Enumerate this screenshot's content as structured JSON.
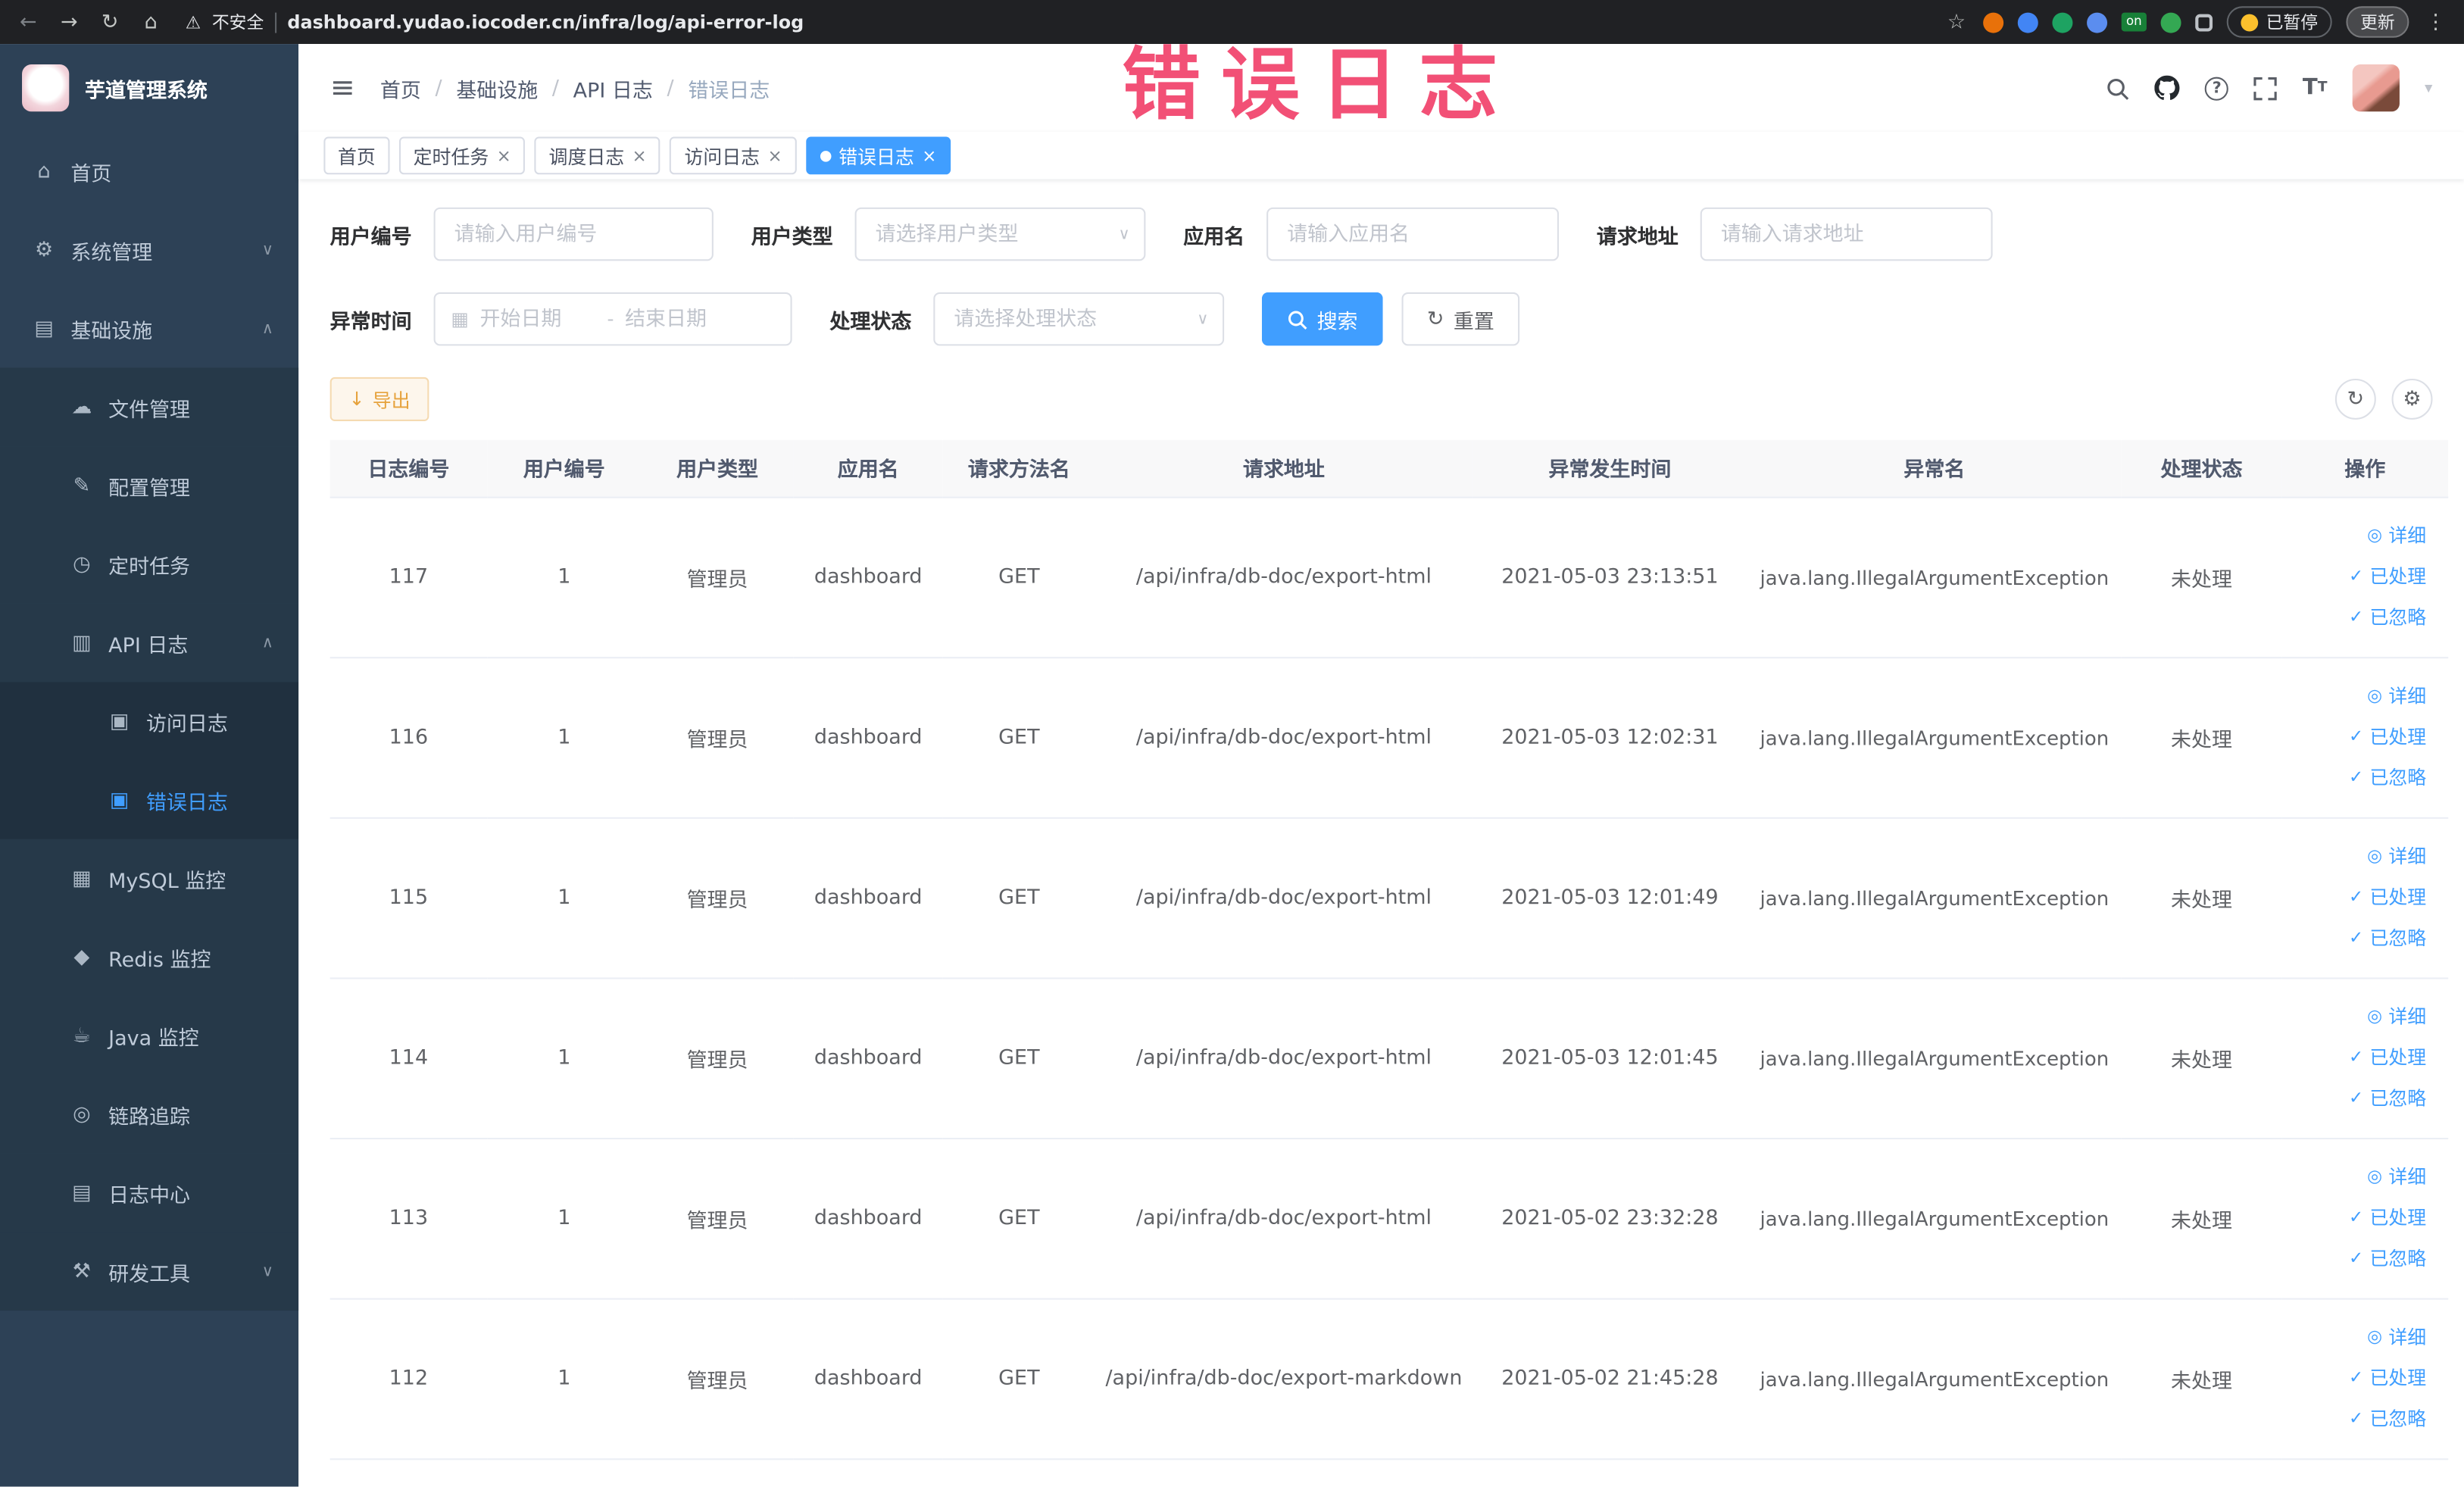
{
  "colors": {
    "accent": "#409eff",
    "sidebar_bg": "#2d4156",
    "submenu_bg": "#263949",
    "link": "#409eff",
    "warning_text": "#e6a23c",
    "warning_bg": "#fdf6ec",
    "annotation": "#f1426b",
    "tag_active": "#409eff"
  },
  "icons": {
    "back": "←",
    "forward": "→",
    "reload": "↻",
    "home": "⌂",
    "warning": "⚠",
    "star": "☆",
    "kebab": "⋮",
    "hamburger": "≡",
    "chevron_down": "∨",
    "chevron_up": "∧",
    "close": "×",
    "dot": "●",
    "eye": "◎",
    "check": "✓",
    "refresh": "↻",
    "settings": "⚙",
    "download": "↓",
    "calendar": "▦",
    "caret_down": "▾",
    "question": "?",
    "font_size": "T"
  },
  "browser": {
    "security_label": "不安全",
    "url": "dashboard.yudao.iocoder.cn/infra/log/api-error-log",
    "paused_badge": "已暂停",
    "update_label": "更新",
    "on_badge": "on"
  },
  "annotation": {
    "text": "错误日志"
  },
  "sidebar": {
    "logo_title": "芋道管理系统",
    "items": [
      {
        "label": "首页",
        "icon": "⌂"
      },
      {
        "label": "系统管理",
        "icon": "⚙"
      },
      {
        "label": "基础设施",
        "icon": "▤"
      },
      {
        "label": "文件管理",
        "icon": "☁"
      },
      {
        "label": "配置管理",
        "icon": "✎"
      },
      {
        "label": "定时任务",
        "icon": "◷"
      },
      {
        "label": "API 日志",
        "icon": "▥"
      },
      {
        "label": "访问日志",
        "icon": "▣"
      },
      {
        "label": "错误日志",
        "icon": "▣"
      },
      {
        "label": "MySQL 监控",
        "icon": "▦"
      },
      {
        "label": "Redis 监控",
        "icon": "◆"
      },
      {
        "label": "Java 监控",
        "icon": "☕"
      },
      {
        "label": "链路追踪",
        "icon": "◎"
      },
      {
        "label": "日志中心",
        "icon": "▤"
      },
      {
        "label": "研发工具",
        "icon": "⚒"
      }
    ]
  },
  "breadcrumb": {
    "separator": "/",
    "items": [
      "首页",
      "基础设施",
      "API 日志",
      "错误日志"
    ]
  },
  "tabs": [
    {
      "label": "首页"
    },
    {
      "label": "定时任务"
    },
    {
      "label": "调度日志"
    },
    {
      "label": "访问日志"
    },
    {
      "label": "错误日志"
    }
  ],
  "filters": {
    "user_id": {
      "label": "用户编号",
      "placeholder": "请输入用户编号"
    },
    "user_type": {
      "label": "用户类型",
      "placeholder": "请选择用户类型"
    },
    "app_name": {
      "label": "应用名",
      "placeholder": "请输入应用名"
    },
    "request_url": {
      "label": "请求地址",
      "placeholder": "请输入请求地址"
    },
    "exception_time": {
      "label": "异常时间",
      "start_placeholder": "开始日期",
      "separator": "-",
      "end_placeholder": "结束日期"
    },
    "process_status": {
      "label": "处理状态",
      "placeholder": "请选择处理状态"
    },
    "search_label": "搜索",
    "reset_label": "重置"
  },
  "toolbar": {
    "export_label": "导出"
  },
  "table": {
    "columns": [
      "日志编号",
      "用户编号",
      "用户类型",
      "应用名",
      "请求方法名",
      "请求地址",
      "异常发生时间",
      "异常名",
      "处理状态",
      "操作"
    ],
    "actions": {
      "detail": "详细",
      "processed": "已处理",
      "ignored": "已忽略"
    },
    "rows": [
      {
        "id": "117",
        "user_id": "1",
        "user_type": "管理员",
        "app_name": "dashboard",
        "method": "GET",
        "url": "/api/infra/db-doc/export-html",
        "time": "2021-05-03 23:13:51",
        "exception": "java.lang.IllegalArgumentException",
        "status": "未处理"
      },
      {
        "id": "116",
        "user_id": "1",
        "user_type": "管理员",
        "app_name": "dashboard",
        "method": "GET",
        "url": "/api/infra/db-doc/export-html",
        "time": "2021-05-03 12:02:31",
        "exception": "java.lang.IllegalArgumentException",
        "status": "未处理"
      },
      {
        "id": "115",
        "user_id": "1",
        "user_type": "管理员",
        "app_name": "dashboard",
        "method": "GET",
        "url": "/api/infra/db-doc/export-html",
        "time": "2021-05-03 12:01:49",
        "exception": "java.lang.IllegalArgumentException",
        "status": "未处理"
      },
      {
        "id": "114",
        "user_id": "1",
        "user_type": "管理员",
        "app_name": "dashboard",
        "method": "GET",
        "url": "/api/infra/db-doc/export-html",
        "time": "2021-05-03 12:01:45",
        "exception": "java.lang.IllegalArgumentException",
        "status": "未处理"
      },
      {
        "id": "113",
        "user_id": "1",
        "user_type": "管理员",
        "app_name": "dashboard",
        "method": "GET",
        "url": "/api/infra/db-doc/export-html",
        "time": "2021-05-02 23:32:28",
        "exception": "java.lang.IllegalArgumentException",
        "status": "未处理"
      },
      {
        "id": "112",
        "user_id": "1",
        "user_type": "管理员",
        "app_name": "dashboard",
        "method": "GET",
        "url": "/api/infra/db-doc/export-markdown",
        "time": "2021-05-02 21:45:28",
        "exception": "java.lang.IllegalArgumentException",
        "status": "未处理"
      }
    ]
  }
}
